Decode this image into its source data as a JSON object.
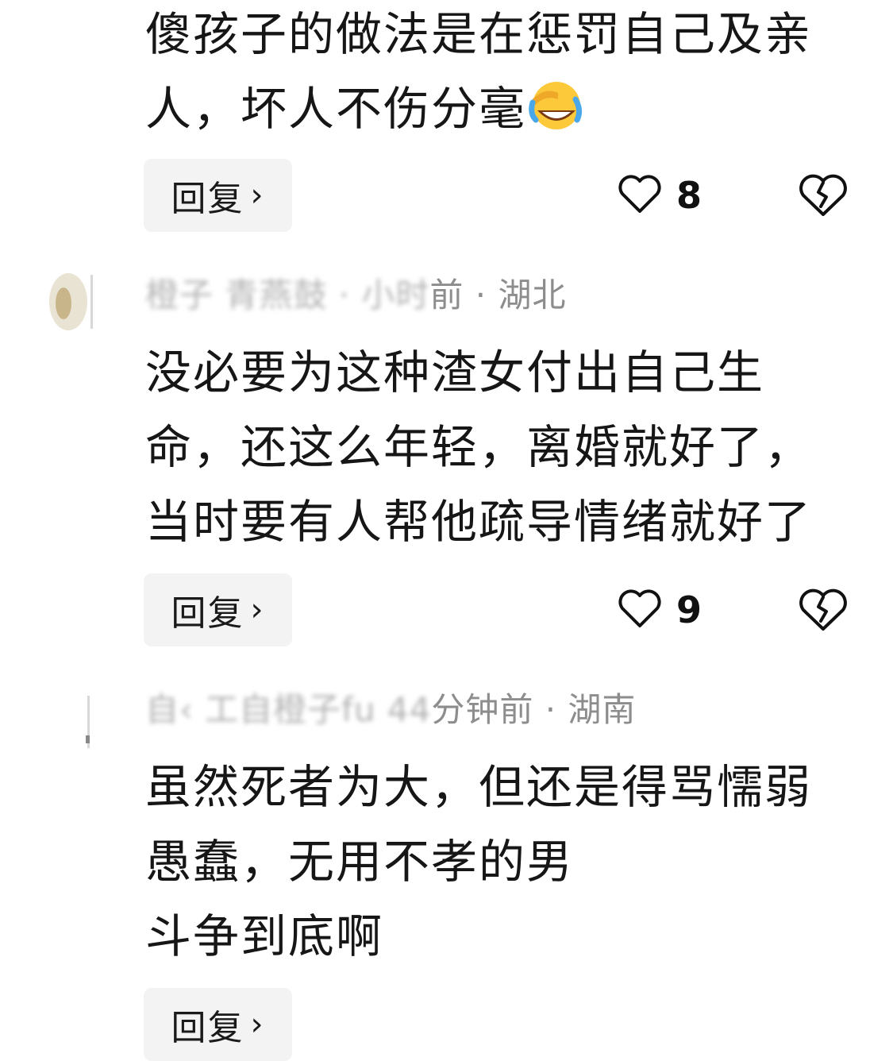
{
  "comments": [
    {
      "text_lines": [
        "傻孩子的做法是在惩罚自己及亲",
        "人，坏人不伤分毫"
      ],
      "emoji": "laughing-crying-face-icon",
      "reply_label": "回复",
      "likes": "8"
    },
    {
      "meta_blurred": "橙子 青燕鼓 · 小时",
      "meta_visible": "前 · 湖北",
      "text_lines": [
        "没必要为这种渣女付出自己生",
        "命，还这么年轻，离婚就好了，",
        "当时要有人帮他疏导情绪就好了"
      ],
      "reply_label": "回复",
      "likes": "9"
    },
    {
      "meta_blurred": "自‹ 工自橙子fu 44",
      "meta_visible": "分钟前 · 湖南",
      "text_lines": [
        "虽然死者为大，但还是得骂懦弱",
        "愚蠢，无用不孝的男",
        "斗争到底啊"
      ],
      "reply_label": "回复"
    }
  ]
}
